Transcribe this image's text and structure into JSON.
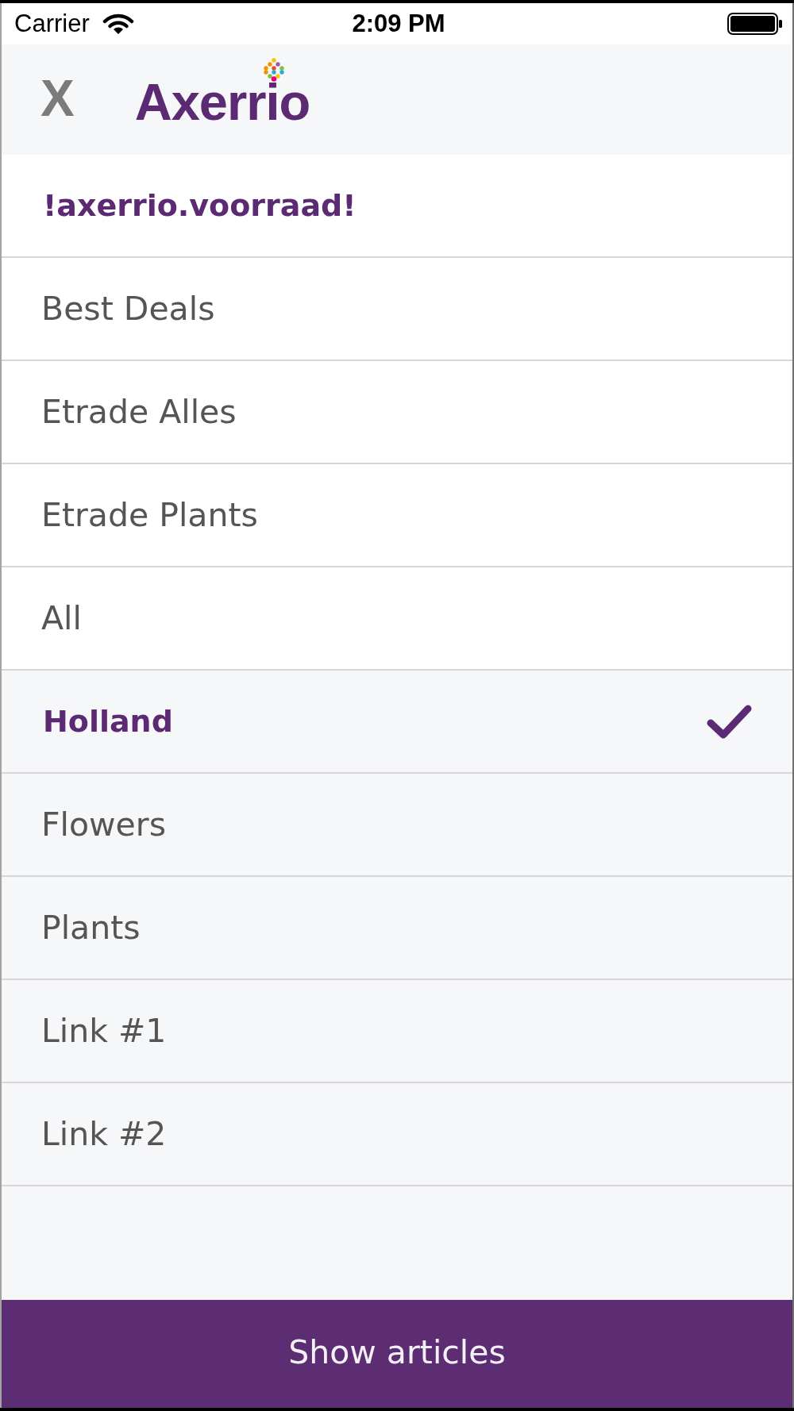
{
  "status_bar": {
    "carrier": "Carrier",
    "time": "2:09 PM"
  },
  "header": {
    "close": "X",
    "logo": "Axerrio"
  },
  "menu": {
    "sections": [
      {
        "kind": "primary",
        "items": [
          {
            "label": "!axerrio.voorraad!",
            "selected": true,
            "checked": false
          },
          {
            "label": "Best Deals",
            "selected": false,
            "checked": false
          },
          {
            "label": "Etrade Alles",
            "selected": false,
            "checked": false
          },
          {
            "label": "Etrade Plants",
            "selected": false,
            "checked": false
          },
          {
            "label": "All",
            "selected": false,
            "checked": false
          }
        ]
      },
      {
        "kind": "secondary",
        "items": [
          {
            "label": "Holland",
            "selected": true,
            "checked": true
          },
          {
            "label": "Flowers",
            "selected": false,
            "checked": false
          },
          {
            "label": "Plants",
            "selected": false,
            "checked": false
          },
          {
            "label": "Link #1",
            "selected": false,
            "checked": false
          },
          {
            "label": "Link #2",
            "selected": false,
            "checked": false
          }
        ]
      }
    ]
  },
  "action_button": {
    "label": "Show articles"
  }
}
